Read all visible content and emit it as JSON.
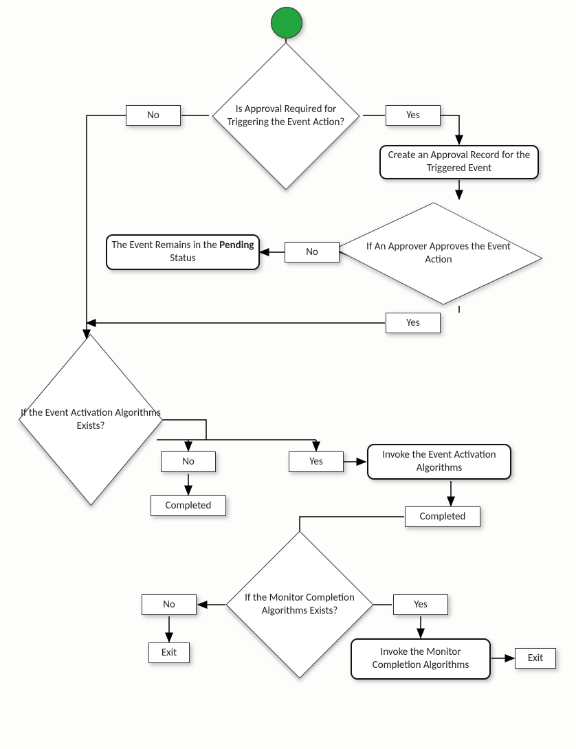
{
  "start": {
    "label": ""
  },
  "decisions": {
    "approval_required": "Is Approval Required for Triggering the Event Action?",
    "approver_approves": "If An Approver Approves the Event Action",
    "activation_exists": "If the Event Activation Algorithms Exists?",
    "monitor_exists": "If the Monitor Completion Algorithms Exists?"
  },
  "processes": {
    "create_approval": "Create an Approval Record for the Triggered Event",
    "pending_prefix": "The Event Remains in the ",
    "pending_bold": "Pending",
    "pending_suffix": " Status",
    "invoke_activation": "Invoke the Event Activation Algorithms",
    "invoke_monitor": "Invoke the Monitor Completion Algorithms"
  },
  "labels": {
    "yes": "Yes",
    "no": "No",
    "completed": "Completed",
    "exit": "Exit"
  }
}
